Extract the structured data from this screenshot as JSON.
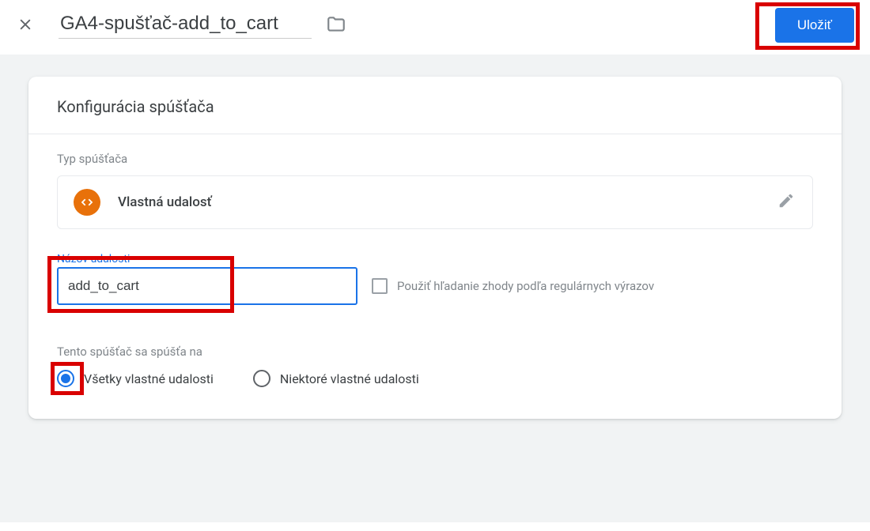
{
  "header": {
    "title": "GA4-spušťač-add_to_cart",
    "save_label": "Uložiť"
  },
  "card": {
    "title": "Konfigurácia spúšťača",
    "type_label": "Typ spúšťača",
    "type_name": "Vlastná udalosť",
    "event_name_label": "Názov udalosti",
    "event_name_value": "add_to_cart",
    "regex_label": "Použiť hľadanie zhody podľa regulárnych výrazov",
    "fires_on_label": "Tento spúšťač sa spúšťa na",
    "radio_all": "Všetky vlastné udalosti",
    "radio_some": "Niektoré vlastné udalosti"
  }
}
